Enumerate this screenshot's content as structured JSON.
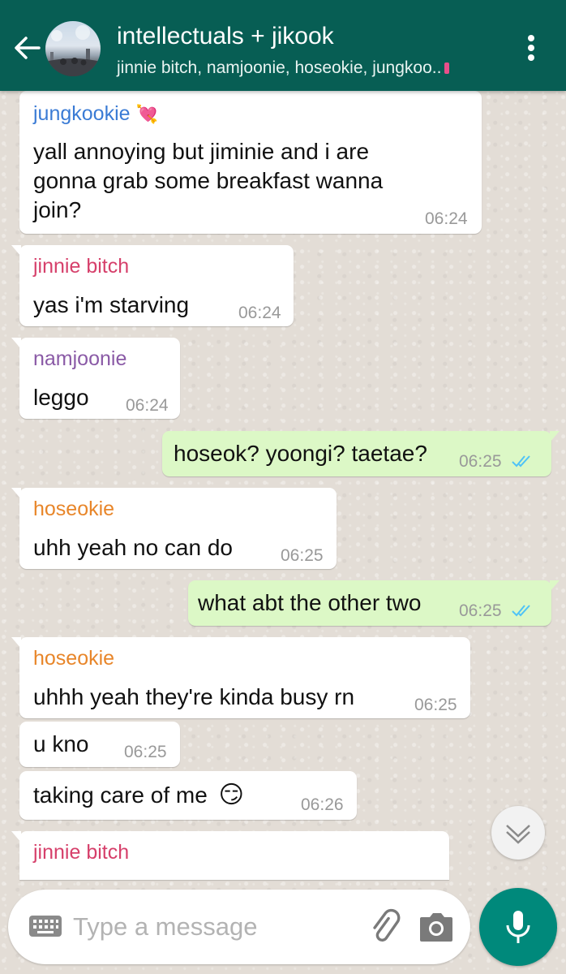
{
  "header": {
    "title": "intellectuals + jikook",
    "subtitle": "jinnie bitch, namjoonie, hoseokie, jungkoo..",
    "back_icon": "arrow-left-icon",
    "menu_icon": "more-vert-icon"
  },
  "messages": [
    {
      "sender": "jungkookie",
      "sender_color": "#3a7bd5",
      "text_lines": [
        "yall annoying but jiminie and i are",
        "gonna grab some breakfast wanna",
        "join?"
      ],
      "time": "06:24",
      "emoji": "💘"
    },
    {
      "sender": "jinnie bitch",
      "sender_color": "#d6406b",
      "text": "yas i'm starving",
      "time": "06:24"
    },
    {
      "sender": "namjoonie",
      "sender_color": "#8a5aa6",
      "text": "leggo",
      "time": "06:24"
    },
    {
      "outgoing": true,
      "text": "hoseok? yoongi? taetae?",
      "time": "06:25",
      "status": "read"
    },
    {
      "sender": "hoseokie",
      "sender_color": "#e8862a",
      "text": "uhh yeah no can do",
      "time": "06:25"
    },
    {
      "outgoing": true,
      "text": "what abt the other two",
      "time": "06:25",
      "status": "read"
    },
    {
      "sender": "hoseokie",
      "sender_color": "#e8862a",
      "text": "uhhh yeah they're kinda busy rn",
      "time": "06:25"
    },
    {
      "text": "u kno",
      "time": "06:25"
    },
    {
      "text": "taking care of me",
      "emoji": "😏",
      "time": "06:26"
    },
    {
      "sender": "jinnie bitch",
      "sender_color": "#d6406b"
    }
  ],
  "composer": {
    "placeholder": "Type a message",
    "keyboard_icon": "keyboard-icon",
    "attach_icon": "paperclip-icon",
    "camera_icon": "camera-icon",
    "mic_icon": "microphone-icon"
  },
  "colors": {
    "header": "#075e54",
    "outgoing_bubble": "#dcf8c6",
    "incoming_bubble": "#ffffff",
    "mic_button": "#00897b",
    "read_ticks": "#4fc3f7"
  }
}
